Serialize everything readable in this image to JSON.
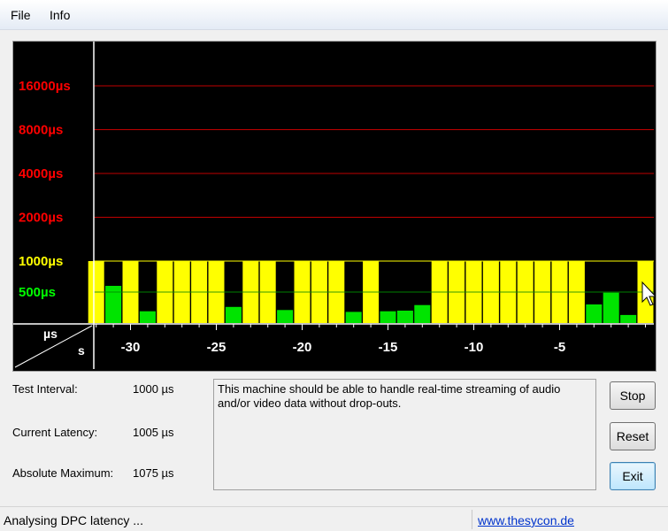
{
  "menu": {
    "file": "File",
    "info": "Info"
  },
  "chart_data": {
    "type": "bar",
    "y_labels": [
      {
        "text": "16000µs",
        "value": 16000,
        "color": "#ff0000"
      },
      {
        "text": "8000µs",
        "value": 8000,
        "color": "#ff0000"
      },
      {
        "text": "4000µs",
        "value": 4000,
        "color": "#ff0000"
      },
      {
        "text": "2000µs",
        "value": 2000,
        "color": "#ff0000"
      },
      {
        "text": "1000µs",
        "value": 1000,
        "color": "#ffff00"
      },
      {
        "text": "500µs",
        "value": 500,
        "color": "#00ff00"
      }
    ],
    "y_unit": "µs",
    "x_unit": "s",
    "x_ticks": [
      -30,
      -25,
      -20,
      -15,
      -10,
      -5
    ],
    "x_range": [
      -32,
      0
    ],
    "green_threshold": 1000,
    "bar_colors": {
      "yellow": "#ffff00",
      "green": "#00e400"
    },
    "series": [
      {
        "x": -32,
        "value": 1000
      },
      {
        "x": -31,
        "value": 600
      },
      {
        "x": -30,
        "value": 1000
      },
      {
        "x": -29,
        "value": 190
      },
      {
        "x": -28,
        "value": 1000
      },
      {
        "x": -27,
        "value": 1050
      },
      {
        "x": -26,
        "value": 1075
      },
      {
        "x": -25,
        "value": 1000
      },
      {
        "x": -24,
        "value": 260
      },
      {
        "x": -23,
        "value": 1000
      },
      {
        "x": -22,
        "value": 1000
      },
      {
        "x": -21,
        "value": 210
      },
      {
        "x": -20,
        "value": 1000
      },
      {
        "x": -19,
        "value": 1000
      },
      {
        "x": -18,
        "value": 1000
      },
      {
        "x": -17,
        "value": 180
      },
      {
        "x": -16,
        "value": 1000
      },
      {
        "x": -15,
        "value": 190
      },
      {
        "x": -14,
        "value": 200
      },
      {
        "x": -13,
        "value": 290
      },
      {
        "x": -12,
        "value": 1000
      },
      {
        "x": -11,
        "value": 1000
      },
      {
        "x": -10,
        "value": 1000
      },
      {
        "x": -9,
        "value": 1050
      },
      {
        "x": -8,
        "value": 1000
      },
      {
        "x": -7,
        "value": 1050
      },
      {
        "x": -6,
        "value": 1020
      },
      {
        "x": -5,
        "value": 1000
      },
      {
        "x": -4,
        "value": 1000
      },
      {
        "x": -3,
        "value": 300
      },
      {
        "x": -2,
        "value": 490
      },
      {
        "x": -1,
        "value": 130
      },
      {
        "x": 0,
        "value": 1000
      }
    ]
  },
  "info": {
    "test_interval_label": "Test Interval:",
    "test_interval_value": "1000 µs",
    "current_latency_label": "Current Latency:",
    "current_latency_value": "1005 µs",
    "absolute_max_label": "Absolute Maximum:",
    "absolute_max_value": "1075 µs"
  },
  "message": "This machine should be able to handle real-time streaming of audio and/or video data without drop-outs.",
  "buttons": {
    "stop": "Stop",
    "reset": "Reset",
    "exit": "Exit"
  },
  "status": {
    "text": "Analysing DPC latency ...",
    "link": "www.thesycon.de"
  }
}
